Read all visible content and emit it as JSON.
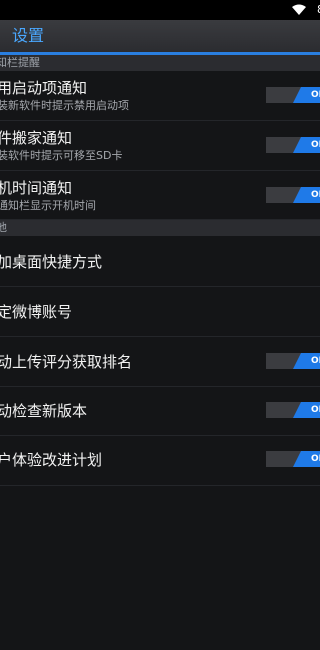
{
  "status_bar": {
    "battery_text": "8"
  },
  "header": {
    "title": "设置"
  },
  "sections": [
    {
      "label": "知栏提醒"
    },
    {
      "label": "他"
    }
  ],
  "rows": [
    {
      "title": "用启动项通知",
      "subtitle": "装新软件时提示禁用启动项",
      "toggle": "ON"
    },
    {
      "title": "件搬家通知",
      "subtitle": "装软件时提示可移至SD卡",
      "toggle": "ON"
    },
    {
      "title": "机时间通知",
      "subtitle": "通知栏显示开机时间",
      "toggle": "ON"
    },
    {
      "title": "加桌面快捷方式"
    },
    {
      "title": "定微博账号"
    },
    {
      "title": "动上传评分获取排名",
      "toggle": "ON"
    },
    {
      "title": "动检查新版本",
      "toggle": "ON"
    },
    {
      "title": "户体验改进计划",
      "toggle": "ON"
    }
  ],
  "colors": {
    "accent": "#2a7fe0",
    "title_text": "#4aa8ff",
    "background": "#141517"
  }
}
